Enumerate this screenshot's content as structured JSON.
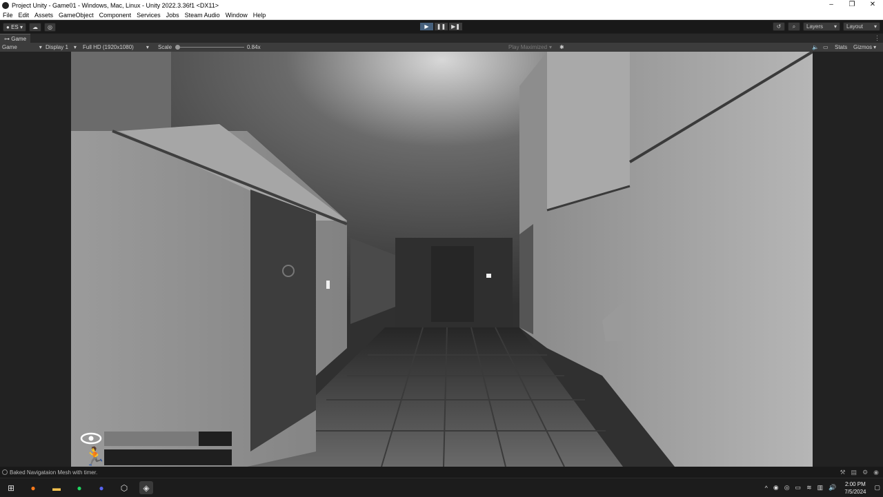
{
  "window": {
    "title": "Project Unity - Game01 - Windows, Mac, Linux - Unity 2022.3.36f1 <DX11>",
    "controls": [
      "–",
      "❐",
      "✕"
    ]
  },
  "menu": [
    "File",
    "Edit",
    "Assets",
    "GameObject",
    "Component",
    "Services",
    "Jobs",
    "Steam Audio",
    "Window",
    "Help"
  ],
  "toolbar": {
    "account_label": "ES",
    "layers_label": "Layers",
    "layout_label": "Layout"
  },
  "tab": {
    "label": "Game"
  },
  "gamebar": {
    "mode": "Game",
    "display": "Display 1",
    "resolution": "Full HD (1920x1080)",
    "scale_label": "Scale",
    "scale_value": "0.84x",
    "play_maximized": "Play Maximized",
    "stats": "Stats",
    "gizmos": "Gizmos"
  },
  "hud": {
    "vision_level": 0.74,
    "stamina_level": 0.0
  },
  "status": {
    "message": "Baked Navigataion Mesh with timer."
  },
  "clock": {
    "time": "2:00 PM",
    "date": "7/5/2024"
  },
  "colors": {
    "play_active": "#46607c",
    "editor_bg": "#1e1e1e",
    "panel": "#3c3c3c"
  }
}
